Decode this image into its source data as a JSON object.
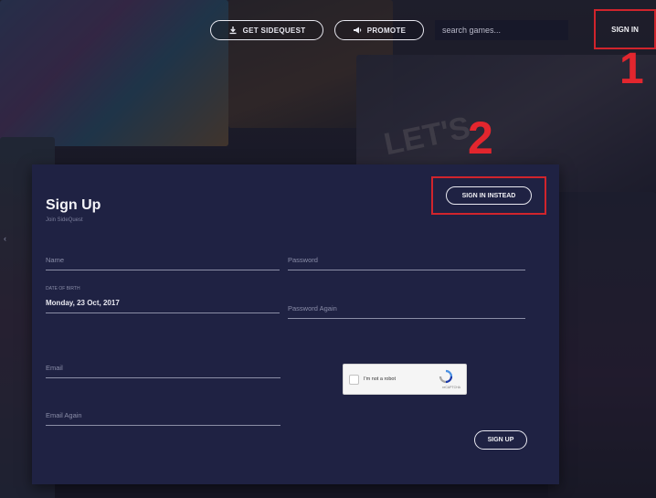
{
  "topbar": {
    "get_sidequest_label": "GET SIDEQUEST",
    "promote_label": "PROMOTE",
    "search_placeholder": "search games...",
    "sign_in_label": "SIGN IN"
  },
  "annotations": {
    "marker_1": "1",
    "marker_2": "2"
  },
  "background": {
    "poster_text": "LET'S"
  },
  "form": {
    "title": "Sign Up",
    "subtitle": "Join SideQuest",
    "sign_in_instead_label": "SIGN IN INSTEAD",
    "name_placeholder": "Name",
    "password_placeholder": "Password",
    "dob_caption": "DATE OF BIRTH",
    "dob_value": "Monday, 23 Oct, 2017",
    "password_again_placeholder": "Password Again",
    "email_placeholder": "Email",
    "email_again_placeholder": "Email Again",
    "captcha_label": "I'm not a robot",
    "captcha_footer": "reCAPTCHA",
    "sign_up_label": "SIGN UP"
  },
  "colors": {
    "panel": "#1f2243",
    "highlight_red": "#d0242c",
    "text": "#f0f0f4",
    "muted": "#8a8da8"
  },
  "icons": {
    "get_sidequest": "download-icon",
    "promote": "megaphone-icon",
    "captcha": "recaptcha-icon"
  }
}
